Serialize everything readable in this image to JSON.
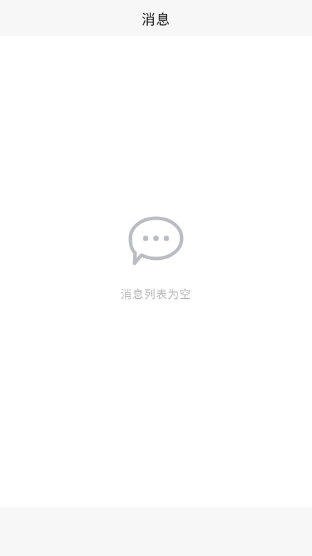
{
  "header": {
    "title": "消息"
  },
  "empty_state": {
    "icon": "chat-bubble-icon",
    "message": "消息列表为空"
  },
  "colors": {
    "header_bg": "#f7f7f7",
    "icon_gray": "#b9bdc2",
    "empty_text": "#b3b3b3",
    "bottom_bar_bg": "#f7f7f7"
  }
}
